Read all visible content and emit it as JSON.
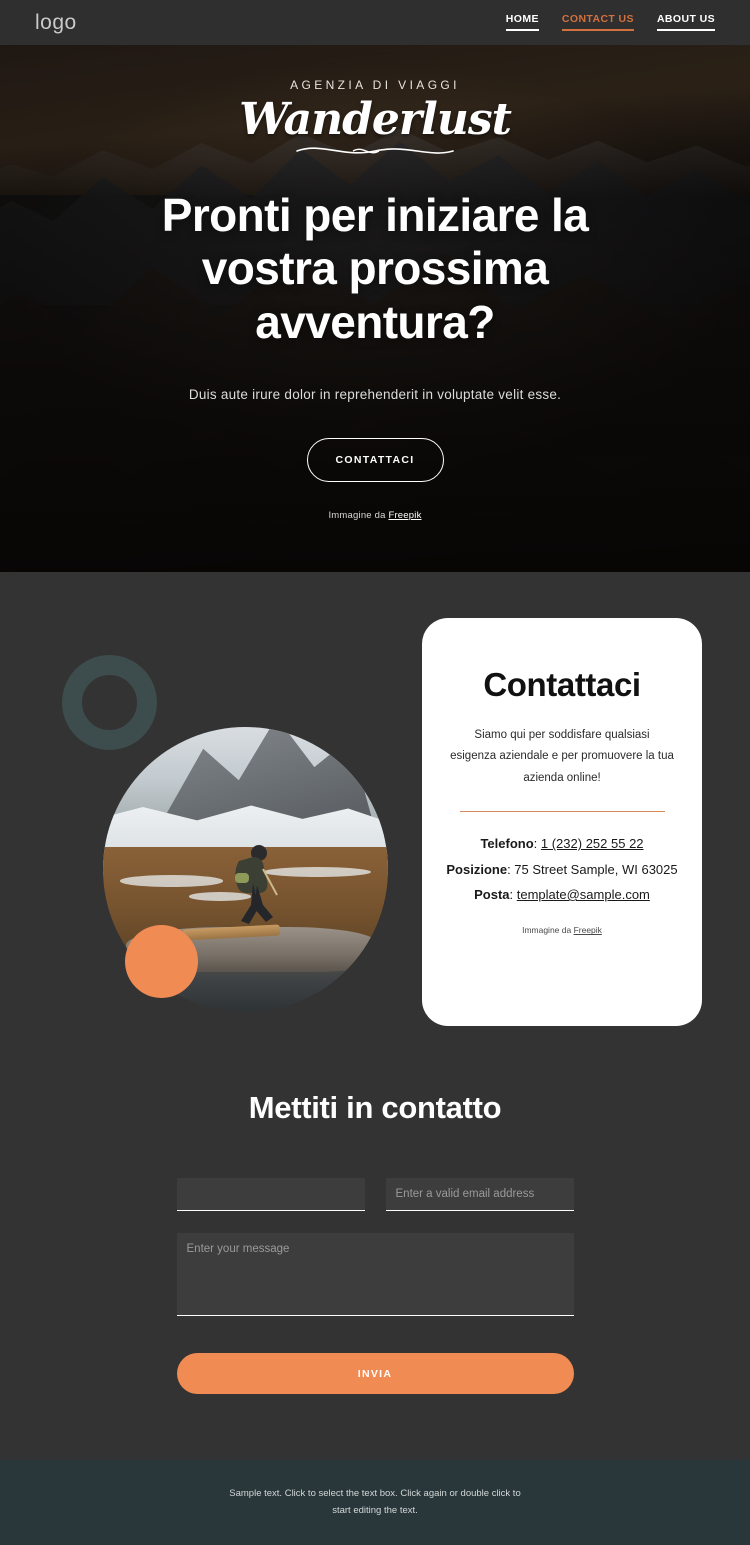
{
  "navbar": {
    "logo": "logo",
    "links": [
      {
        "label": "HOME",
        "accent": false
      },
      {
        "label": "CONTACT US",
        "accent": true
      },
      {
        "label": "ABOUT US",
        "accent": false
      }
    ]
  },
  "hero": {
    "kicker": "AGENZIA DI VIAGGI",
    "wordmark": "Wanderlust",
    "headline": "Pronti per iniziare la vostra prossima avventura?",
    "subtitle": "Duis aute irure dolor in reprehenderit in voluptate velit esse.",
    "cta_label": "CONTATTACI",
    "credit_prefix": "Immagine da ",
    "credit_link": "Freepik"
  },
  "contact_card": {
    "title": "Contattaci",
    "description": "Siamo qui per soddisfare qualsiasi esigenza aziendale e per promuovere la tua azienda online!",
    "phone_label": "Telefono",
    "phone_value": "1 (232) 252 55 22",
    "location_label": "Posizione",
    "location_value": "75 Street Sample, WI 63025",
    "mail_label": "Posta",
    "mail_value": "template@sample.com",
    "credit_prefix": "Immagine da ",
    "credit_link": "Freepik"
  },
  "form": {
    "title": "Mettiti in contatto",
    "name_value": "",
    "name_placeholder": "",
    "email_placeholder": "Enter a valid email address",
    "message_placeholder": "Enter your message",
    "submit_label": "INVIA"
  },
  "footer": {
    "text": "Sample text. Click to select the text box. Click again or double click to start editing the text."
  },
  "colors": {
    "accent_orange": "#f18b54",
    "nav_accent": "#d2703f",
    "page_background": "#333333",
    "footer_background": "#29373a",
    "ring_teal": "#3d4c4c",
    "card_rule": "#d98a5c"
  }
}
